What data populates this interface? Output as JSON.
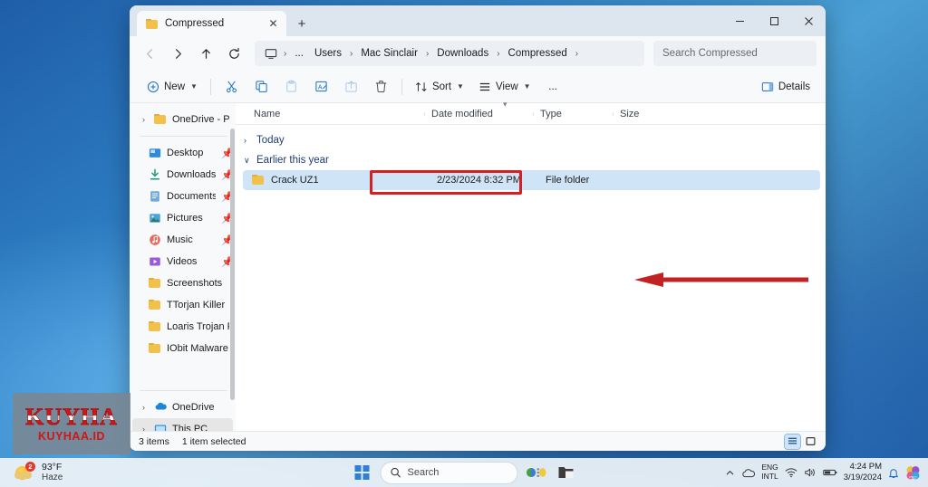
{
  "window": {
    "tab": {
      "title": "Compressed",
      "folder_icon": "folder-icon",
      "close_icon": "close-icon"
    },
    "new_tab_label": "+",
    "controls": {
      "minimize": "minimize-icon",
      "maximize": "maximize-icon",
      "close": "close-icon"
    }
  },
  "address": {
    "back_icon": "back-arrow-icon",
    "forward_icon": "forward-arrow-icon",
    "up_icon": "up-arrow-icon",
    "refresh_icon": "refresh-icon",
    "pc_icon": "this-pc-icon",
    "overflow": "...",
    "crumbs": [
      "Users",
      "Mac Sinclair",
      "Downloads",
      "Compressed"
    ],
    "search_placeholder": "Search Compressed"
  },
  "toolbar": {
    "new_label": "New",
    "cut_label": "Cut",
    "copy_label": "Copy",
    "paste_label": "Paste",
    "rename_label": "Rename",
    "share_label": "Share",
    "delete_label": "Delete",
    "sort_label": "Sort",
    "view_label": "View",
    "more_label": "...",
    "details_label": "Details"
  },
  "sidebar": {
    "onedrive_personal": {
      "label": "OneDrive - Pers",
      "icon": "folder-icon"
    },
    "quick_access": [
      {
        "label": "Desktop",
        "icon": "desktop-icon",
        "pinned": true
      },
      {
        "label": "Downloads",
        "icon": "downloads-icon",
        "pinned": true
      },
      {
        "label": "Documents",
        "icon": "documents-icon",
        "pinned": true
      },
      {
        "label": "Pictures",
        "icon": "pictures-icon",
        "pinned": true
      },
      {
        "label": "Music",
        "icon": "music-icon",
        "pinned": true
      },
      {
        "label": "Videos",
        "icon": "videos-icon",
        "pinned": true
      },
      {
        "label": "Screenshots",
        "icon": "folder-icon",
        "pinned": false
      },
      {
        "label": "TTorjan Killer",
        "icon": "folder-icon",
        "pinned": false
      },
      {
        "label": "Loaris Trojan Re",
        "icon": "folder-icon",
        "pinned": false
      },
      {
        "label": "IObit Malware F",
        "icon": "folder-icon",
        "pinned": false
      }
    ],
    "drives": [
      {
        "label": "OneDrive",
        "icon": "onedrive-cloud-icon",
        "selected": false
      },
      {
        "label": "This PC",
        "icon": "this-pc-icon",
        "selected": true
      }
    ]
  },
  "columns": [
    {
      "key": "name",
      "label": "Name",
      "sorted": true
    },
    {
      "key": "date",
      "label": "Date modified"
    },
    {
      "key": "type",
      "label": "Type"
    },
    {
      "key": "size",
      "label": "Size"
    }
  ],
  "groups": [
    {
      "label": "Today",
      "expanded": false,
      "caret": "›",
      "rows": []
    },
    {
      "label": "Earlier this year",
      "expanded": true,
      "caret": "∨",
      "rows": [
        {
          "name": "Crack UZ1",
          "date": "2/23/2024 8:32 PM",
          "type": "File folder",
          "size": "",
          "icon": "folder-icon",
          "selected": true,
          "annotated": true
        }
      ]
    }
  ],
  "status": {
    "item_count": "3 items",
    "selection": "1 item selected",
    "view_details_icon": "details-view-icon",
    "view_tiles_icon": "large-icons-view-icon"
  },
  "watermark": {
    "main": "KUYHA",
    "sub": "KUYHAA.ID"
  },
  "taskbar": {
    "weather": {
      "temp": "93°F",
      "condition": "Haze",
      "badge": "2"
    },
    "start_label": "Start",
    "search_placeholder": "Search",
    "apps": [
      "widgets-icon",
      "file-explorer-icon"
    ],
    "tray": {
      "overflow_icon": "chevron-up-icon",
      "onedrive_icon": "onedrive-cloud-icon",
      "language": {
        "line1": "ENG",
        "line2": "INTL"
      },
      "wifi_icon": "wifi-icon",
      "volume_icon": "speaker-icon",
      "battery_icon": "battery-icon",
      "time": "4:24 PM",
      "date": "3/19/2024",
      "notification_icon": "bell-icon",
      "app_icon": "store-icon"
    }
  },
  "annotations": {
    "highlight_color": "#d32020",
    "arrow": "left-arrow-annotation"
  }
}
